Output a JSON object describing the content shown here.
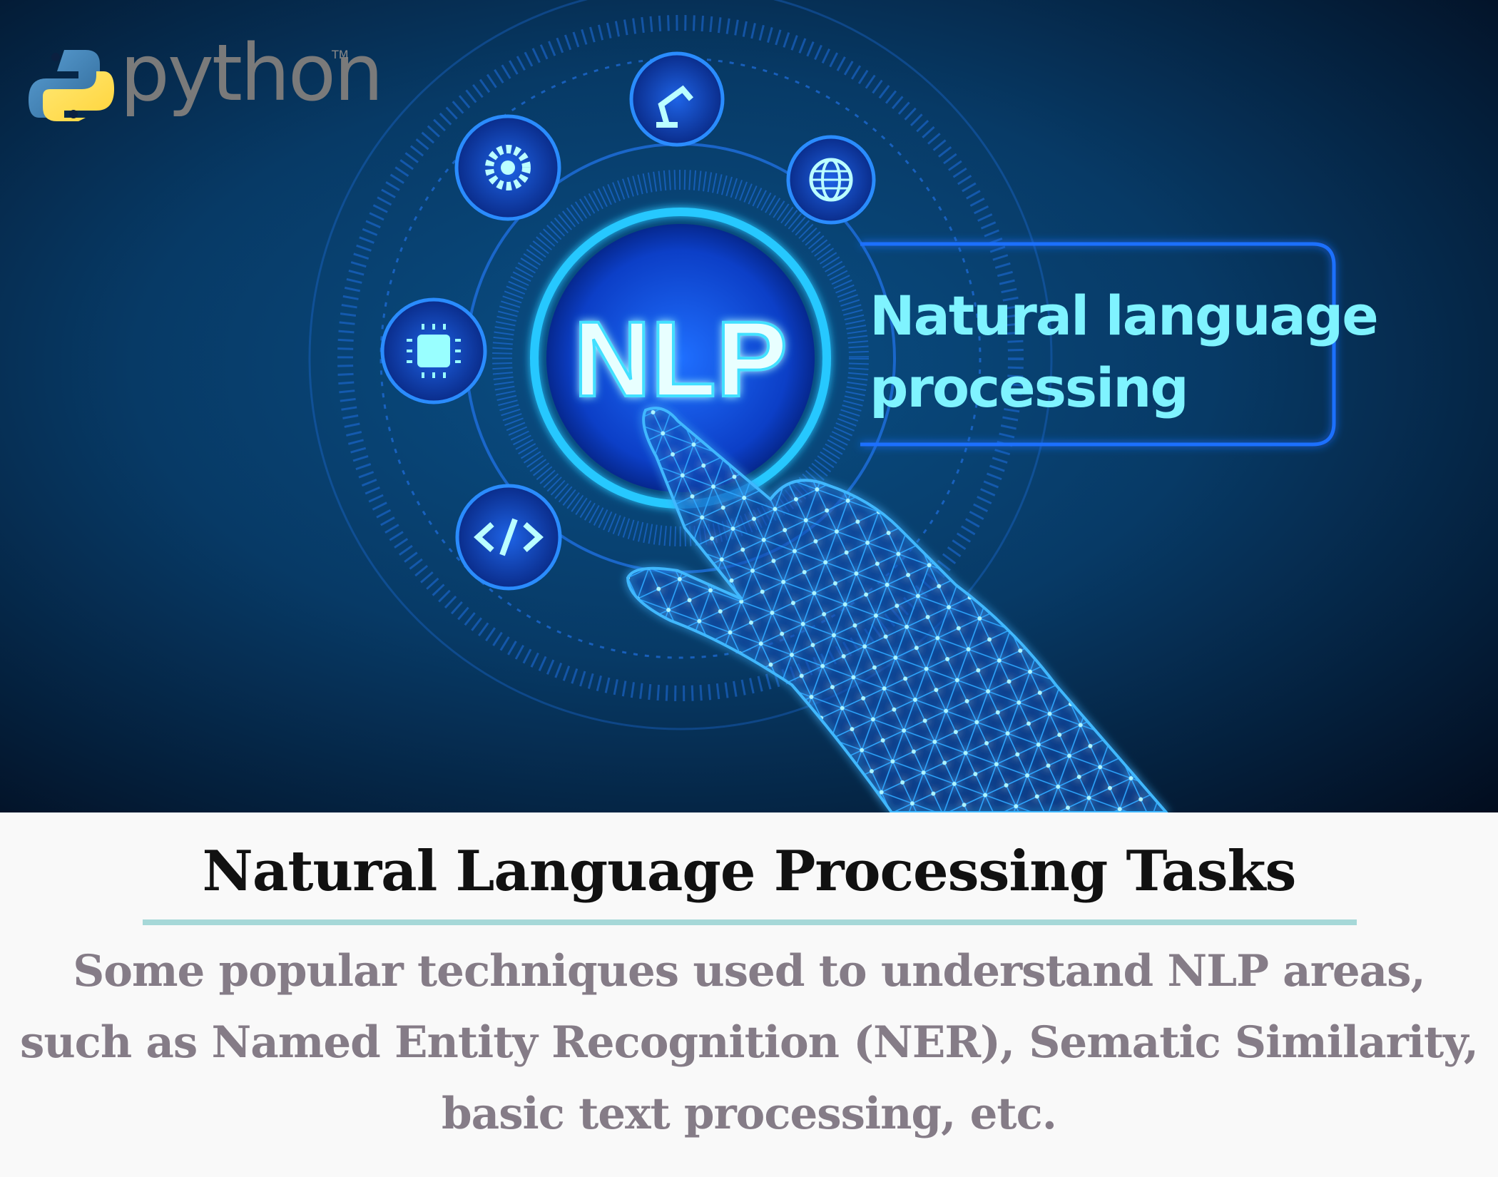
{
  "banner": {
    "logo_text": "python",
    "logo_tm": "TM",
    "badge_text": "NLP",
    "label_line1": "Natural language",
    "label_line2": "processing",
    "icons": [
      "gear-icon",
      "robot-arm-icon",
      "globe-icon",
      "chip-icon",
      "code-icon"
    ],
    "colors": {
      "background_dark": "#04142e",
      "glow": "#1a7cff",
      "text_cyan": "#7ff3ff",
      "python_blue": "#3e78ad",
      "python_yellow": "#ffd43b"
    }
  },
  "caption": {
    "title": "Natural Language Processing Tasks",
    "description": "Some popular techniques used to understand NLP areas, such as Named Entity Recognition (NER), Sematic Similarity, basic text processing, etc.",
    "colors": {
      "title": "#111111",
      "rule": "#a6d8d8",
      "description": "#857c87"
    }
  }
}
